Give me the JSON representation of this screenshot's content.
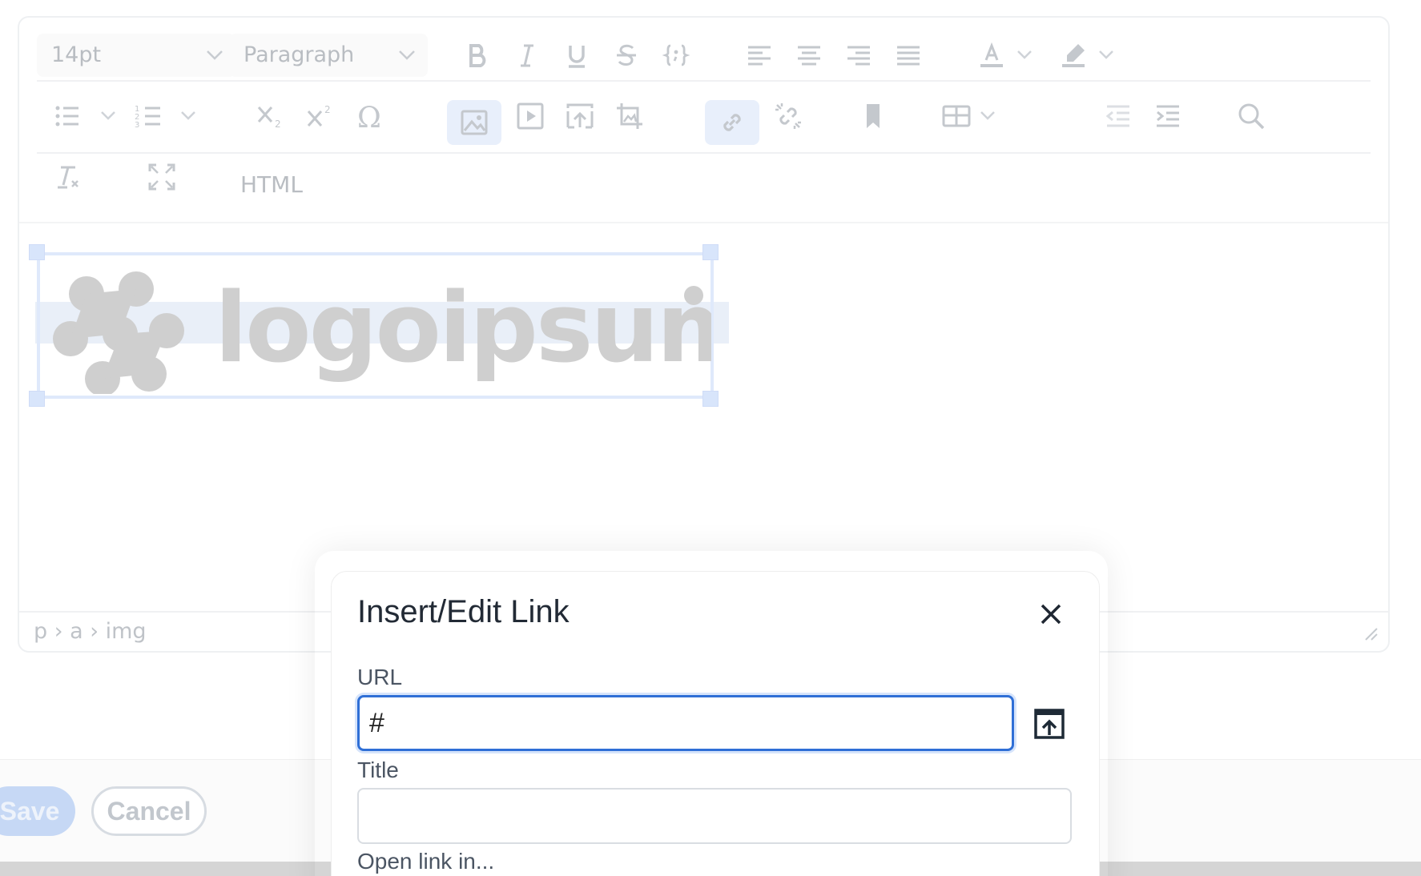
{
  "toolbar": {
    "font_size": "14pt",
    "block_format": "Paragraph",
    "html_label": "HTML"
  },
  "statusbar": {
    "path": "p › a › img"
  },
  "content": {
    "logo_text": "logoipsum"
  },
  "actions": {
    "save_label": "Save",
    "cancel_label": "Cancel"
  },
  "dialog": {
    "title": "Insert/Edit Link",
    "url_label": "URL",
    "url_value": "#",
    "title_label": "Title",
    "title_value": "",
    "open_link_label": "Open link in..."
  },
  "colors": {
    "accent": "#2f6fd6",
    "toolbar_icon": "#c4c8cd",
    "active_bg": "#e8effb"
  }
}
